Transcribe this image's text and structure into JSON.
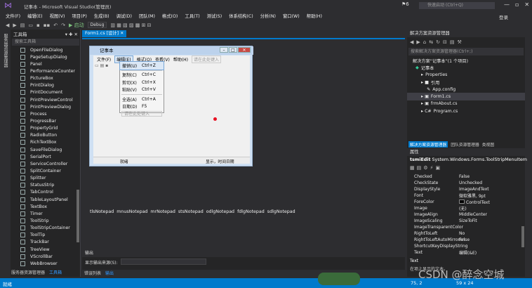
{
  "window": {
    "title": "记事本 - Microsoft Visual Studio(管理员)",
    "quick_launch": "快速启动 (Ctrl+Q)",
    "notif_count": "6",
    "login": "登录"
  },
  "menubar": [
    "文件(F)",
    "编辑(E)",
    "视图(V)",
    "项目(P)",
    "生成(B)",
    "调试(D)",
    "团队(M)",
    "格式(O)",
    "工具(T)",
    "测试(S)",
    "体系结构(C)",
    "分析(N)",
    "窗口(W)",
    "帮助(H)"
  ],
  "toolbar": {
    "start": "▶ 启动",
    "config": "Debug"
  },
  "left_rail": {
    "label": "服务器资源管理器"
  },
  "toolbox": {
    "title": "工具箱",
    "search_placeholder": "搜索工具箱",
    "items": [
      "OpenFileDialog",
      "PageSetupDialog",
      "Panel",
      "PerformanceCounter",
      "PictureBox",
      "PrintDialog",
      "PrintDocument",
      "PrintPreviewControl",
      "PrintPreviewDialog",
      "Process",
      "ProgressBar",
      "PropertyGrid",
      "RadioButton",
      "RichTextBox",
      "SaveFileDialog",
      "SerialPort",
      "ServiceController",
      "SplitContainer",
      "Splitter",
      "StatusStrip",
      "TabControl",
      "TableLayoutPanel",
      "TextBox",
      "Timer",
      "ToolStrip",
      "ToolStripContainer",
      "ToolTip",
      "TrackBar",
      "TreeView",
      "VScrollBar",
      "WebBrowser"
    ],
    "bottom_tabs": [
      "服务器资源管理器",
      "工具箱"
    ]
  },
  "doc_tab": "Form1.cs [设计] ✕",
  "form": {
    "title": "记事本",
    "menu": [
      "文件(F)",
      "编辑(E)",
      "格式(O)",
      "查看(V)",
      "帮助(H)"
    ],
    "menu_placeholder": "请在此处键入",
    "status_left": "就绪",
    "status_right": "显示，时间日期"
  },
  "dropdown": [
    {
      "label": "撤销(U)",
      "shortcut": "Ctrl+Z"
    },
    {
      "label": "复制(C)",
      "shortcut": "Ctrl+C"
    },
    {
      "label": "剪切(X)",
      "shortcut": "Ctrl+X"
    },
    {
      "label": "粘贴(V)",
      "shortcut": "Ctrl+V"
    },
    {
      "label": "全选(A)",
      "shortcut": "Ctrl+A"
    },
    {
      "label": "日期(D)",
      "shortcut": "F5"
    }
  ],
  "dropdown_placeholder": "请在此处键入",
  "tray": [
    "tlsNotepad",
    "mnusNotepad",
    "mrNotepad",
    "stsNotepad",
    "odlgNotepad",
    "fdlgNotepad",
    "sdlgNotepad"
  ],
  "output": {
    "title": "输出",
    "source_label": "显示输出来源(S):"
  },
  "bottom_tabs": [
    "错误列表",
    "输出"
  ],
  "solution": {
    "title": "解决方案资源管理器",
    "search_placeholder": "搜索解决方案资源管理器(Ctrl+;)",
    "tree": [
      "解决方案“记事本”(1 个项目)",
      "记事本",
      "Properties",
      "引用",
      "App.config",
      "Form1.cs",
      "frmAbout.cs",
      "Program.cs"
    ],
    "tabs": [
      "解决方案资源管理器",
      "团队资源管理器",
      "类视图"
    ]
  },
  "properties": {
    "title": "属性",
    "object": "tsmiEdit",
    "object_type": "System.Windows.Forms.ToolStripMenuItem",
    "rows": [
      {
        "name": "Checked",
        "value": "False"
      },
      {
        "name": "CheckState",
        "value": "Unchecked"
      },
      {
        "name": "DisplayStyle",
        "value": "ImageAndText"
      },
      {
        "name": "Font",
        "value": "微软雅黑, 9pt"
      },
      {
        "name": "ForeColor",
        "value": "ControlText"
      },
      {
        "name": "Image",
        "value": "(无)"
      },
      {
        "name": "ImageAlign",
        "value": "MiddleCenter"
      },
      {
        "name": "ImageScaling",
        "value": "SizeToFit"
      },
      {
        "name": "ImageTransparentColor",
        "value": ""
      },
      {
        "name": "RightToLeft",
        "value": "No"
      },
      {
        "name": "RightToLeftAutoMirrorIm",
        "value": "False"
      },
      {
        "name": "ShortcutKeyDisplayString",
        "value": ""
      },
      {
        "name": "Text",
        "value": "编辑(&E)"
      }
    ],
    "desc_title": "Text",
    "desc": "在项上显示的文本。"
  },
  "status": {
    "text": "就绪",
    "pos": "75, 2",
    "size": "59 x 24"
  },
  "watermark": "CSDN @醉念空城"
}
